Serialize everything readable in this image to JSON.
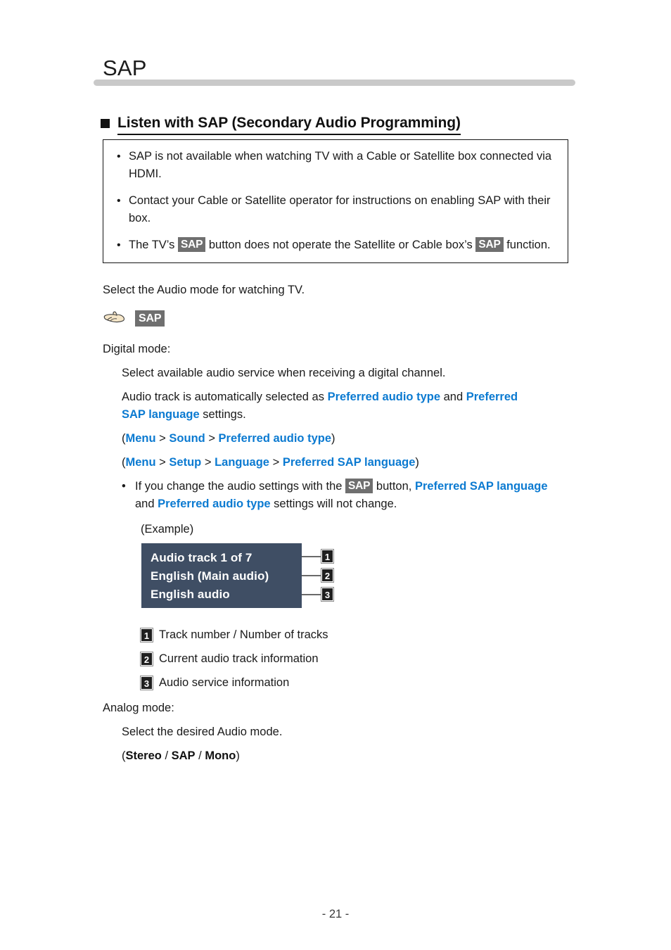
{
  "page": {
    "title": "SAP",
    "footer": "- 21 -"
  },
  "section": {
    "heading": "Listen with SAP (Secondary Audio Programming)"
  },
  "note_box": {
    "bullet_glyph": "•",
    "items": [
      {
        "id": "note-hdmi",
        "parts": [
          {
            "type": "text",
            "value": "SAP is not available when watching TV with a Cable or Satellite box connected via HDMI."
          }
        ]
      },
      {
        "id": "note-operator",
        "parts": [
          {
            "type": "text",
            "value": "Contact your Cable or Satellite operator for instructions on enabling SAP with their box."
          }
        ]
      },
      {
        "id": "note-tv-button",
        "parts": [
          {
            "type": "text",
            "value": "The TV’s "
          },
          {
            "type": "key",
            "value": "SAP"
          },
          {
            "type": "text",
            "value": " button does not operate the Satellite or Cable box’s "
          },
          {
            "type": "key",
            "value": "SAP"
          },
          {
            "type": "text",
            "value": " function."
          }
        ]
      }
    ]
  },
  "intro": {
    "select_audio_mode": "Select the Audio mode for watching TV."
  },
  "remote_key": {
    "icon": "pointing-hand-icon",
    "key_label": "SAP"
  },
  "digital": {
    "label": "Digital mode:",
    "line1": "Select available audio service when receiving a digital channel.",
    "line2_pre": "Audio track is automatically selected as ",
    "line2_link1": "Preferred audio type",
    "line2_mid": " and ",
    "line2_link2": "Preferred SAP language",
    "line2_post": " settings.",
    "path1": {
      "open": "(",
      "items": [
        "Menu",
        "Sound",
        "Preferred audio type"
      ],
      "sep": " > ",
      "close": ")"
    },
    "path2": {
      "open": "(",
      "items": [
        "Menu",
        "Setup",
        "Language",
        "Preferred SAP language"
      ],
      "sep": " > ",
      "close": ")"
    },
    "bullet_glyph": "•",
    "note_pre": "If you change the audio settings with the ",
    "note_key": "SAP",
    "note_mid": " button, ",
    "note_link1": "Preferred SAP language",
    "note_and": " and ",
    "note_link2": "Preferred audio type",
    "note_post": " settings will not change."
  },
  "example": {
    "label": "(Example)",
    "osd_lines": [
      "Audio track 1 of 7",
      "English (Main audio)",
      "English audio"
    ],
    "markers": [
      "1",
      "2",
      "3"
    ],
    "panel_color": "#3f4e64",
    "legend": [
      {
        "marker": "1",
        "text": "Track number / Number of tracks"
      },
      {
        "marker": "2",
        "text": "Current audio track information"
      },
      {
        "marker": "3",
        "text": "Audio service information"
      }
    ]
  },
  "analog": {
    "label": "Analog mode:",
    "line1": "Select the desired Audio mode.",
    "open": "(",
    "options": [
      "Stereo",
      "SAP",
      "Mono"
    ],
    "sep": " / ",
    "close": ")"
  },
  "colors": {
    "link_blue": "#0b7ad1",
    "key_badge_gray": "#6f6f6f",
    "rule_gray": "#c9c9c9",
    "osd_panel": "#3f4e64",
    "marker_dark": "#1f1f1f"
  }
}
